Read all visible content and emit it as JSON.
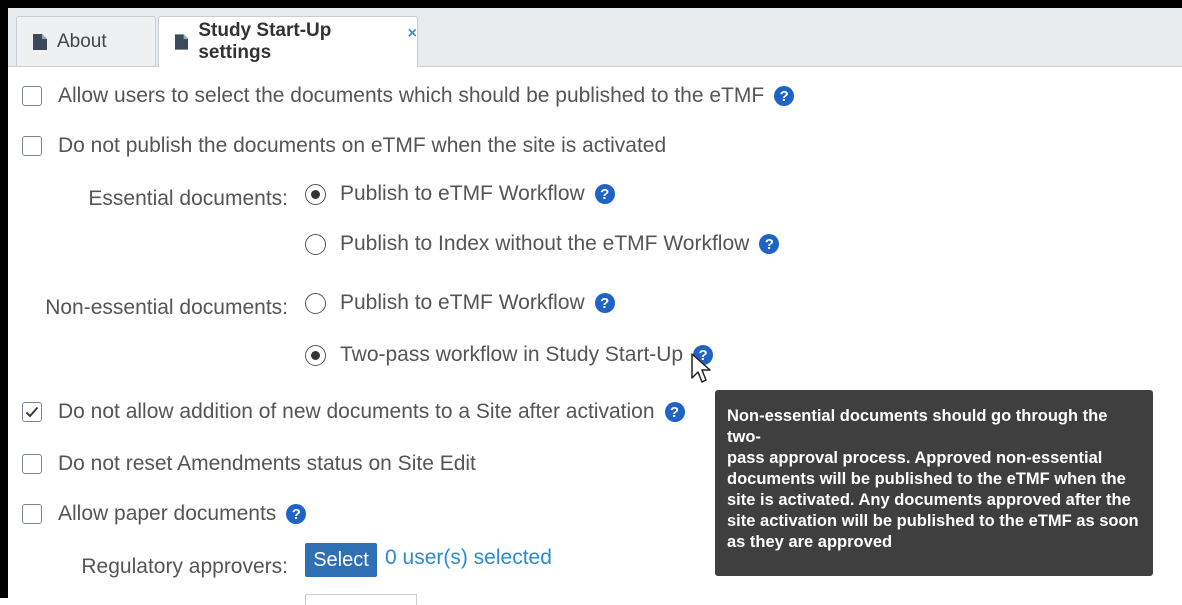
{
  "tabs": [
    {
      "label": "About",
      "active": false
    },
    {
      "label": "Study Start-Up settings",
      "active": true,
      "close_glyph": "×"
    }
  ],
  "settings": {
    "allow_select_docs": {
      "label": "Allow users to select the documents which should be published to the eTMF",
      "checked": false
    },
    "no_publish_on_activation": {
      "label": "Do not publish the documents on eTMF when the site is activated",
      "checked": false
    },
    "essential": {
      "label": "Essential documents:",
      "options": [
        {
          "label": "Publish to eTMF Workflow",
          "selected": true
        },
        {
          "label": "Publish to Index without the eTMF Workflow",
          "selected": false
        }
      ]
    },
    "non_essential": {
      "label": "Non-essential documents:",
      "options": [
        {
          "label": "Publish to eTMF Workflow",
          "selected": false
        },
        {
          "label": "Two-pass workflow in Study Start-Up",
          "selected": true
        }
      ]
    },
    "no_addition_after_activation": {
      "label": "Do not allow addition of new documents to a Site after activation",
      "checked": true
    },
    "no_reset_amendments": {
      "label": "Do not reset Amendments status on Site Edit",
      "checked": false
    },
    "allow_paper": {
      "label": "Allow paper documents",
      "checked": false
    },
    "regulatory_approvers": {
      "label": "Regulatory approvers:",
      "button": "Select",
      "selected_text": "0 user(s) selected"
    }
  },
  "tooltip": {
    "lines": [
      "Non-essential documents should go through the two-",
      "pass approval process. Approved non-essential",
      "documents will be published to the eTMF when the",
      "site is activated. Any documents approved after the",
      "site activation will be published to the eTMF as soon",
      "as they are approved"
    ]
  },
  "help_glyph": "?",
  "colors": {
    "accent": "#1f63c6",
    "link": "#2a8bd1",
    "button": "#2f6fb3",
    "tooltip_bg": "#3f3f3f"
  }
}
